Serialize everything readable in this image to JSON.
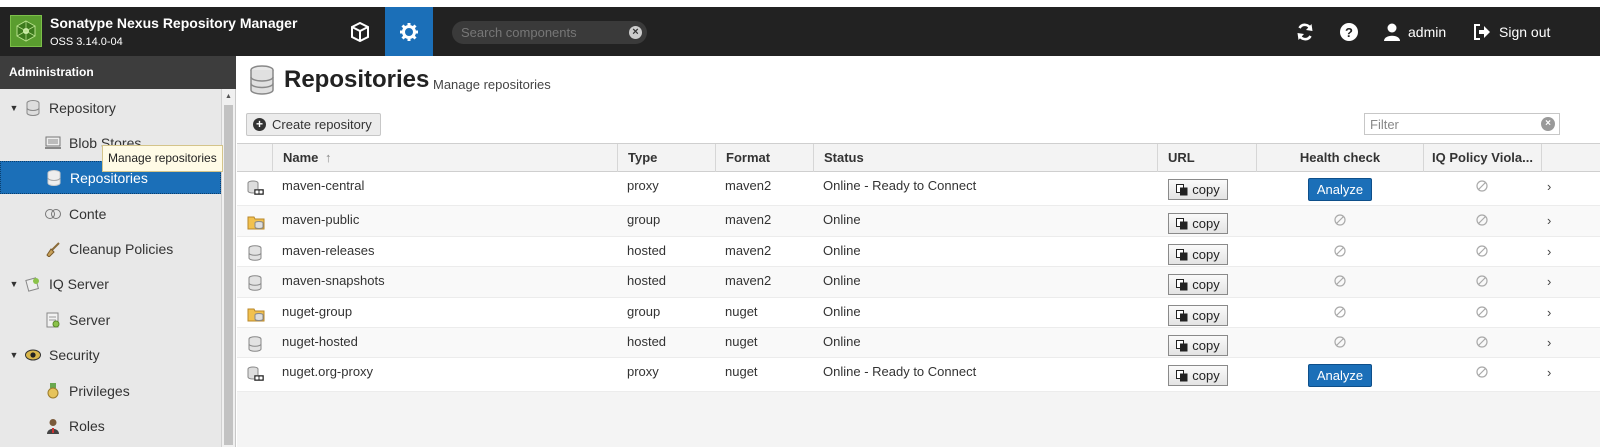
{
  "header": {
    "app_name": "Sonatype Nexus Repository Manager",
    "version": "OSS 3.14.0-04",
    "search_placeholder": "Search components",
    "user": "admin",
    "signout": "Sign out"
  },
  "sidebar": {
    "title": "Administration",
    "items": [
      {
        "label": "Repository",
        "level": 0,
        "icon": "database-icon"
      },
      {
        "label": "Blob Stores",
        "level": 1,
        "icon": "blob-store-icon"
      },
      {
        "label": "Repositories",
        "level": 1,
        "icon": "database-icon",
        "selected": true
      },
      {
        "label": "Content Selectors",
        "level": 1,
        "icon": "content-selector-icon"
      },
      {
        "label": "Cleanup Policies",
        "level": 1,
        "icon": "broom-icon"
      },
      {
        "label": "IQ Server",
        "level": 0,
        "icon": "iq-server-icon"
      },
      {
        "label": "Server",
        "level": 1,
        "icon": "server-icon"
      },
      {
        "label": "Security",
        "level": 0,
        "icon": "security-icon"
      },
      {
        "label": "Privileges",
        "level": 1,
        "icon": "medal-icon"
      },
      {
        "label": "Roles",
        "level": 1,
        "icon": "user-role-icon"
      }
    ],
    "visible_content_label": "Conte",
    "tooltip": "Manage repositories"
  },
  "page": {
    "title": "Repositories",
    "subtitle": "Manage repositories",
    "create_button": "Create repository",
    "filter_placeholder": "Filter"
  },
  "table": {
    "columns": [
      "Name",
      "Type",
      "Format",
      "Status",
      "URL",
      "Health check",
      "IQ Policy Viola..."
    ],
    "sort_indicator": "↑",
    "copy_label": "copy",
    "analyze_label": "Analyze",
    "rows": [
      {
        "name": "maven-central",
        "type": "proxy",
        "format": "maven2",
        "status": "Online - Ready to Connect",
        "icon": "proxy-repo-icon",
        "health": "analyze"
      },
      {
        "name": "maven-public",
        "type": "group",
        "format": "maven2",
        "status": "Online",
        "icon": "group-repo-icon",
        "health": "na"
      },
      {
        "name": "maven-releases",
        "type": "hosted",
        "format": "maven2",
        "status": "Online",
        "icon": "hosted-repo-icon",
        "health": "na"
      },
      {
        "name": "maven-snapshots",
        "type": "hosted",
        "format": "maven2",
        "status": "Online",
        "icon": "hosted-repo-icon",
        "health": "na"
      },
      {
        "name": "nuget-group",
        "type": "group",
        "format": "nuget",
        "status": "Online",
        "icon": "group-repo-icon",
        "health": "na"
      },
      {
        "name": "nuget-hosted",
        "type": "hosted",
        "format": "nuget",
        "status": "Online",
        "icon": "hosted-repo-icon",
        "health": "na"
      },
      {
        "name": "nuget.org-proxy",
        "type": "proxy",
        "format": "nuget",
        "status": "Online - Ready to Connect",
        "icon": "proxy-repo-icon",
        "health": "analyze"
      }
    ]
  },
  "colors": {
    "header_bg": "#222222",
    "accent": "#1b6fb8",
    "sidebar_bg": "#e8e8e8"
  }
}
